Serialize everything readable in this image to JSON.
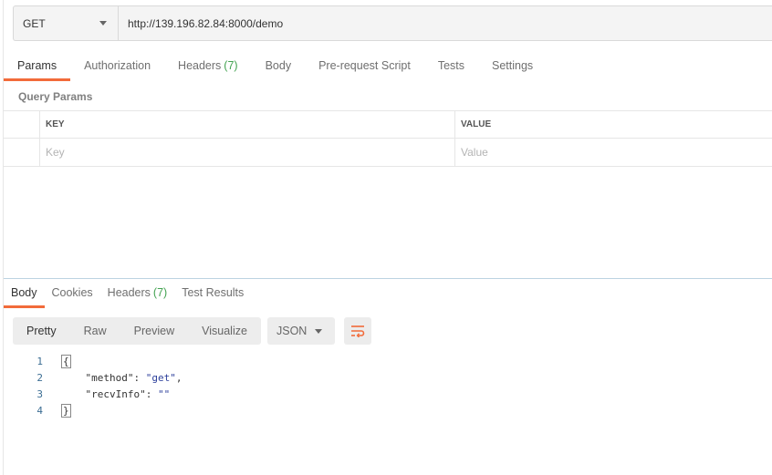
{
  "request": {
    "method": "GET",
    "url": "http://139.196.82.84:8000/demo"
  },
  "request_tabs": [
    {
      "label": "Params",
      "count": null
    },
    {
      "label": "Authorization",
      "count": null
    },
    {
      "label": "Headers",
      "count": "(7)"
    },
    {
      "label": "Body",
      "count": null
    },
    {
      "label": "Pre-request Script",
      "count": null
    },
    {
      "label": "Tests",
      "count": null
    },
    {
      "label": "Settings",
      "count": null
    }
  ],
  "query_params": {
    "title": "Query Params",
    "key_header": "KEY",
    "value_header": "VALUE",
    "key_placeholder": "Key",
    "value_placeholder": "Value"
  },
  "response_tabs": [
    {
      "label": "Body",
      "count": null
    },
    {
      "label": "Cookies",
      "count": null
    },
    {
      "label": "Headers",
      "count": "(7)"
    },
    {
      "label": "Test Results",
      "count": null
    }
  ],
  "view_modes": [
    "Pretty",
    "Raw",
    "Preview",
    "Visualize"
  ],
  "format": "JSON",
  "code": {
    "line_numbers": [
      "1",
      "2",
      "3",
      "4"
    ],
    "open_brace": "{",
    "close_brace": "}",
    "lines": [
      {
        "key": "\"method\"",
        "sep": ": ",
        "value": "\"get\"",
        "trail": ","
      },
      {
        "key": "\"recvInfo\"",
        "sep": ": ",
        "value": "\"\"",
        "trail": ""
      }
    ]
  },
  "colors": {
    "accent": "#f26b3a",
    "count": "#44a352",
    "string": "#2c3f9b"
  },
  "icons": {
    "method_dropdown": "chevron-down-icon",
    "wrap": "wrap-lines-icon"
  }
}
